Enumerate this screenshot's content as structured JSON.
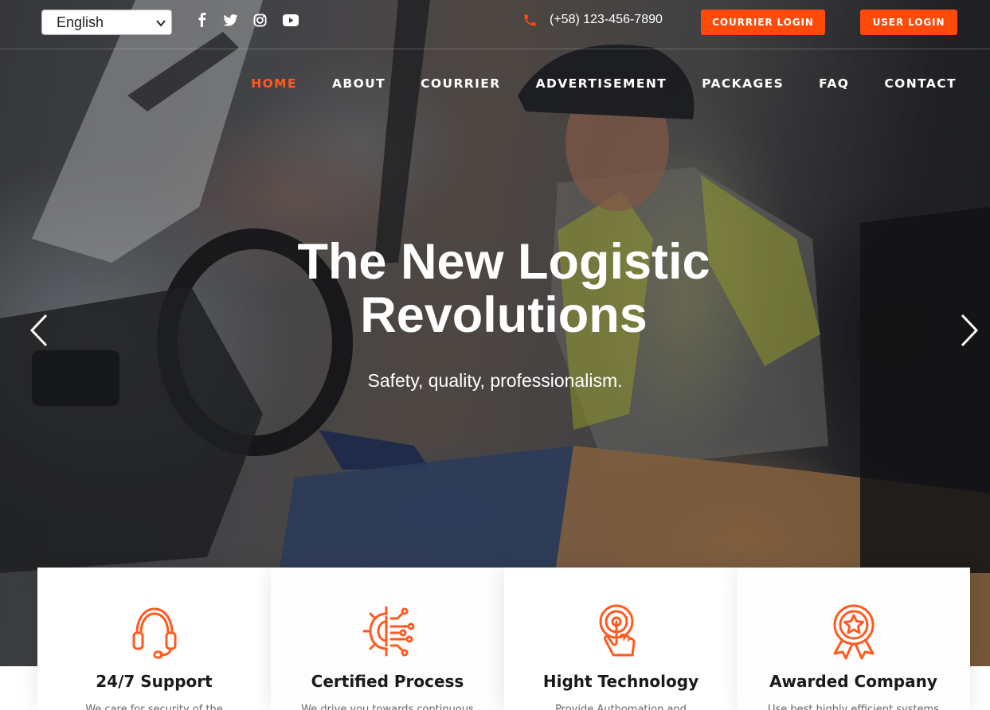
{
  "header": {
    "language": {
      "selected": "English"
    },
    "social": [
      {
        "icon": "facebook-icon"
      },
      {
        "icon": "twitter-icon"
      },
      {
        "icon": "instagram-icon"
      },
      {
        "icon": "youtube-icon"
      }
    ],
    "phone": "(+58) 123-456-7890",
    "courier_login": "COURRIER LOGIN",
    "user_login": "USER LOGIN"
  },
  "nav": {
    "items": [
      "HOME",
      "ABOUT",
      "COURRIER",
      "ADVERTISEMENT",
      "PACKAGES",
      "FAQ",
      "CONTACT"
    ],
    "active": "HOME"
  },
  "hero": {
    "title_line1": "The New Logistic",
    "title_line2": "Revolutions",
    "subtitle": "Safety, quality, professionalism."
  },
  "features": [
    {
      "icon": "headset-icon",
      "title": "24/7 Support",
      "text": "We care for security of the"
    },
    {
      "icon": "gear-circuit-icon",
      "title": "Certified Process",
      "text": "We drive you towards continuous"
    },
    {
      "icon": "touch-tech-icon",
      "title": "Hight Technology",
      "text": "Provide Authomation and"
    },
    {
      "icon": "award-badge-icon",
      "title": "Awarded Company",
      "text": "Use best highly efficient systems"
    }
  ],
  "colors": {
    "accent": "#ff4a0a",
    "nav_active": "#ff5a1f",
    "icon_orange": "#ff5a1f"
  }
}
